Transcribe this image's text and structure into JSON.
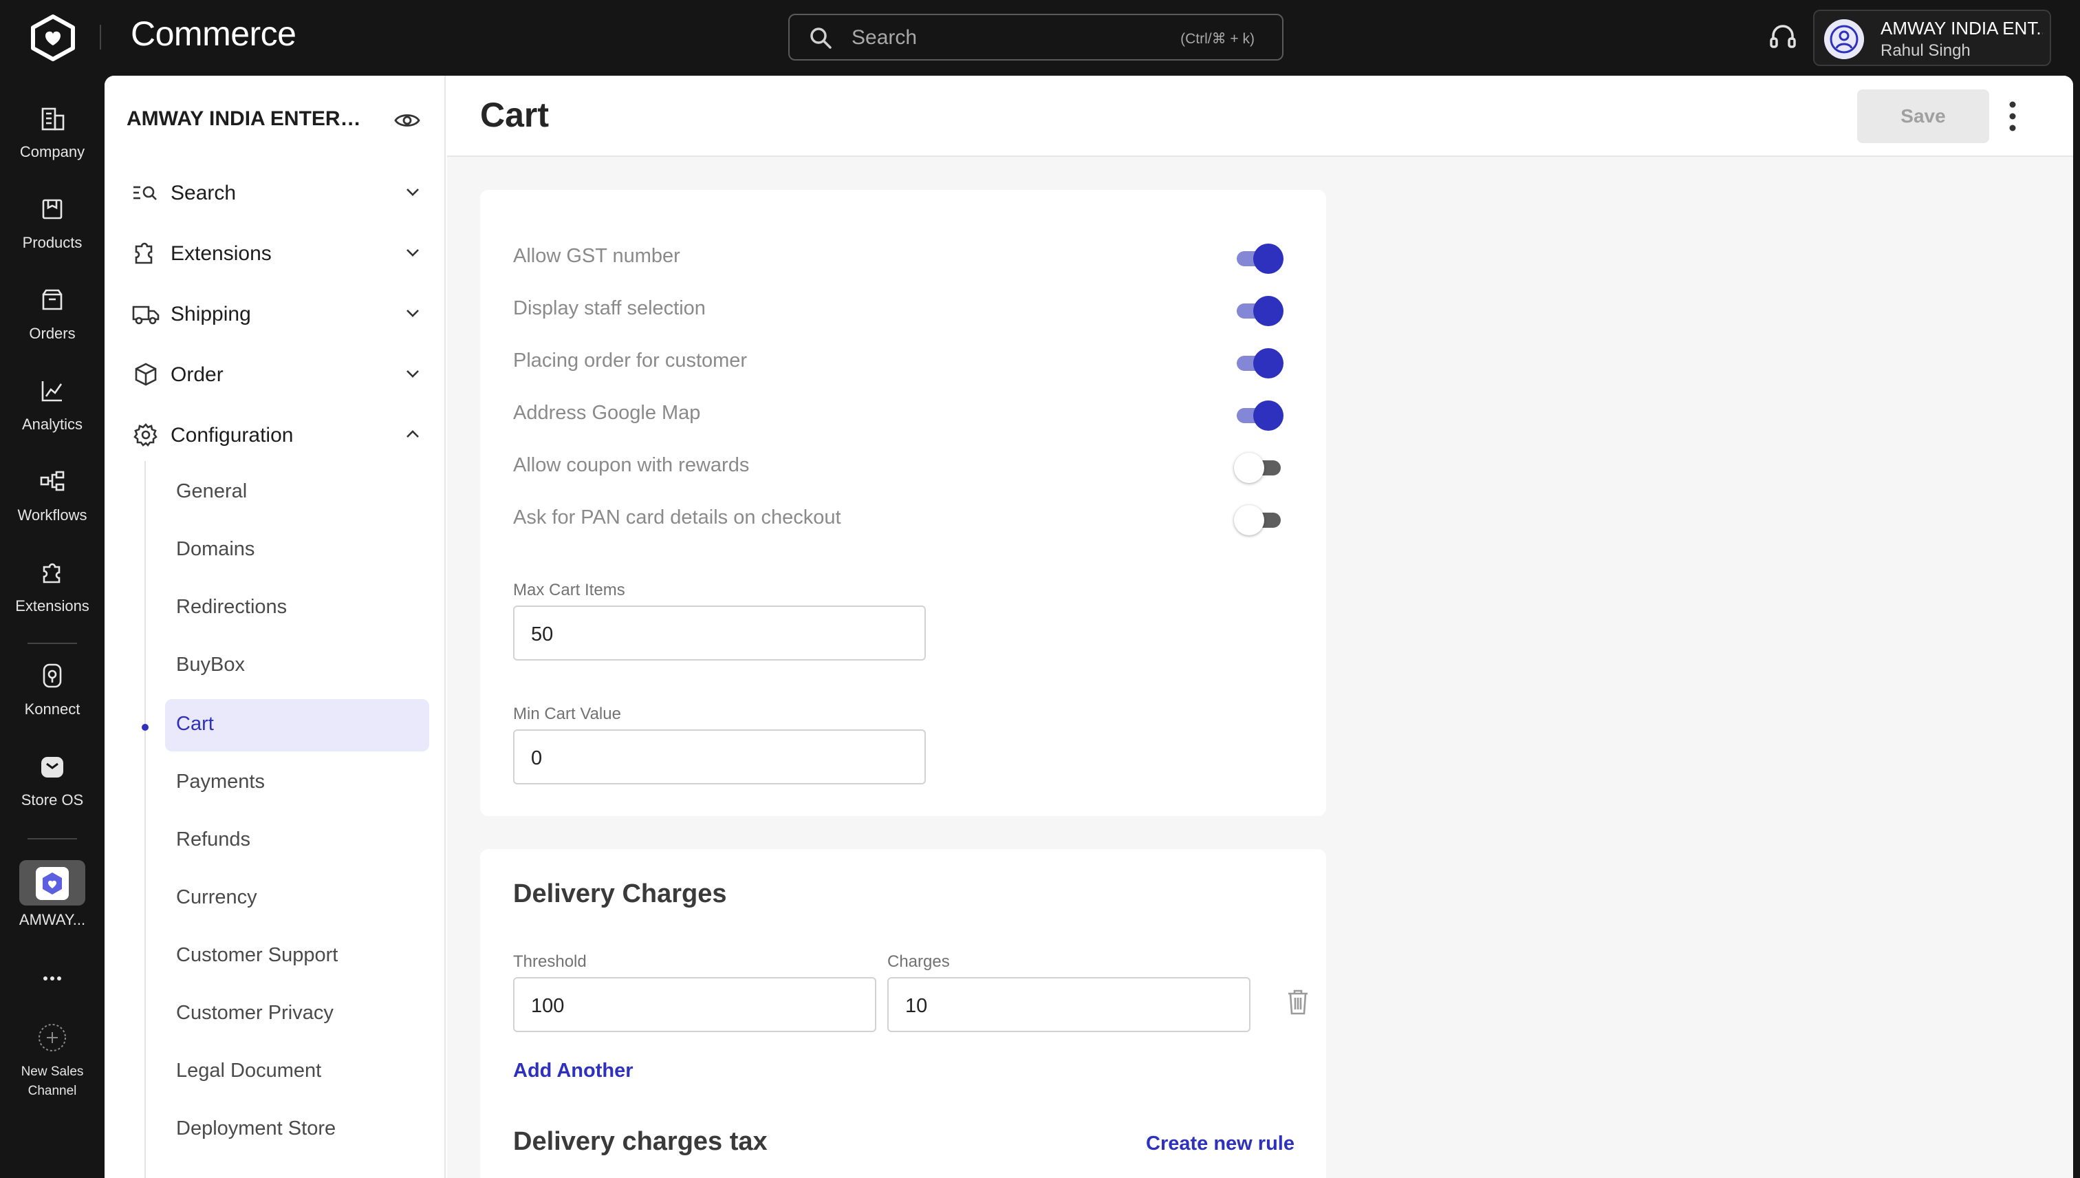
{
  "app": {
    "brand": "Commerce"
  },
  "search": {
    "placeholder": "Search",
    "shortcut": "(Ctrl/⌘ + k)"
  },
  "account": {
    "org": "AMWAY INDIA ENT...",
    "user": "Rahul Singh"
  },
  "rail": {
    "items": [
      {
        "label": "Company",
        "icon": "building-icon"
      },
      {
        "label": "Products",
        "icon": "box-icon"
      },
      {
        "label": "Orders",
        "icon": "orders-icon"
      },
      {
        "label": "Analytics",
        "icon": "chart-icon"
      },
      {
        "label": "Workflows",
        "icon": "workflow-icon"
      },
      {
        "label": "Extensions",
        "icon": "puzzle-icon"
      },
      {
        "label": "Konnect",
        "icon": "konnect-icon"
      },
      {
        "label": "Store OS",
        "icon": "store-os-icon"
      },
      {
        "label": "AMWAY...",
        "icon": "app-icon"
      }
    ],
    "new_channel": "New Sales Channel"
  },
  "sidebar": {
    "org_name": "AMWAY INDIA ENTERPRI...",
    "groups": [
      {
        "label": "Search",
        "icon": "search-list-icon"
      },
      {
        "label": "Extensions",
        "icon": "puzzle-icon"
      },
      {
        "label": "Shipping",
        "icon": "truck-icon"
      },
      {
        "label": "Order",
        "icon": "package-icon"
      },
      {
        "label": "Configuration",
        "icon": "gear-icon"
      }
    ],
    "sub_items": [
      {
        "label": "General"
      },
      {
        "label": "Domains"
      },
      {
        "label": "Redirections"
      },
      {
        "label": "BuyBox"
      },
      {
        "label": "Cart"
      },
      {
        "label": "Payments"
      },
      {
        "label": "Refunds"
      },
      {
        "label": "Currency"
      },
      {
        "label": "Customer Support"
      },
      {
        "label": "Customer Privacy"
      },
      {
        "label": "Legal Document"
      },
      {
        "label": "Deployment Store"
      }
    ],
    "active_item": "Cart"
  },
  "page": {
    "title": "Cart",
    "save_label": "Save"
  },
  "settings": {
    "toggles": [
      {
        "label": "Allow GST number",
        "on": true
      },
      {
        "label": "Display staff selection",
        "on": true
      },
      {
        "label": "Placing order for customer",
        "on": true
      },
      {
        "label": "Address Google Map",
        "on": true
      },
      {
        "label": "Allow coupon with rewards",
        "on": false
      },
      {
        "label": "Ask for PAN card details on checkout",
        "on": false
      }
    ],
    "max_cart_items": {
      "label": "Max Cart Items",
      "value": "50"
    },
    "min_cart_value": {
      "label": "Min Cart Value",
      "value": "0"
    }
  },
  "delivery": {
    "title": "Delivery Charges",
    "threshold_label": "Threshold",
    "threshold_value": "100",
    "charges_label": "Charges",
    "charges_value": "10",
    "add_another": "Add Another",
    "tax_title": "Delivery charges tax",
    "create_rule": "Create new rule"
  },
  "colors": {
    "accent": "#2e31be",
    "toggle_track_on": "#8387d6",
    "toggle_off": "#5e5e5e",
    "topbar": "#151515"
  }
}
